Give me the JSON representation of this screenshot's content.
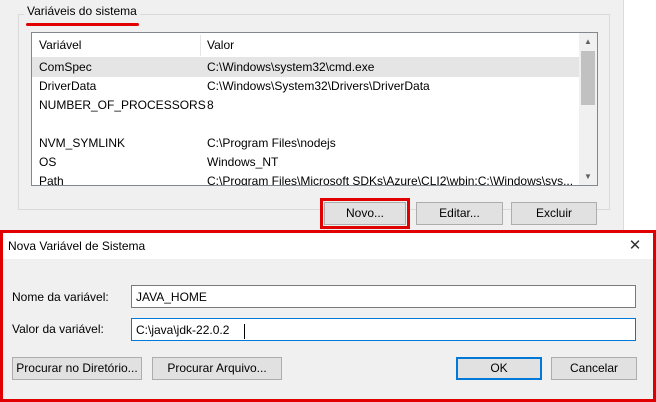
{
  "system_vars": {
    "group_title": "Variáveis do sistema",
    "columns": [
      "Variável",
      "Valor"
    ],
    "rows": [
      {
        "name": "ComSpec",
        "value": "C:\\Windows\\system32\\cmd.exe"
      },
      {
        "name": "DriverData",
        "value": "C:\\Windows\\System32\\Drivers\\DriverData"
      },
      {
        "name": "NUMBER_OF_PROCESSORS",
        "value": "8"
      },
      {
        "name": "",
        "value": ""
      },
      {
        "name": "NVM_SYMLINK",
        "value": "C:\\Program Files\\nodejs"
      },
      {
        "name": "OS",
        "value": "Windows_NT"
      },
      {
        "name": "Path",
        "value": "C:\\Program Files\\Microsoft SDKs\\Azure\\CLI2\\wbin;C:\\Windows\\sys..."
      }
    ],
    "buttons": {
      "new": "Novo...",
      "edit": "Editar...",
      "delete": "Excluir"
    }
  },
  "dialog": {
    "title": "Nova Variável de Sistema",
    "close_glyph": "✕",
    "name_label": "Nome da variável:",
    "name_value": "JAVA_HOME",
    "value_label": "Valor da variável:",
    "value_value": "C:\\java\\jdk-22.0.2",
    "browse_dir": "Procurar no Diretório...",
    "browse_file": "Procurar Arquivo...",
    "ok": "OK",
    "cancel": "Cancelar"
  },
  "colors": {
    "highlight": "#e00000",
    "focus": "#0078d7"
  }
}
